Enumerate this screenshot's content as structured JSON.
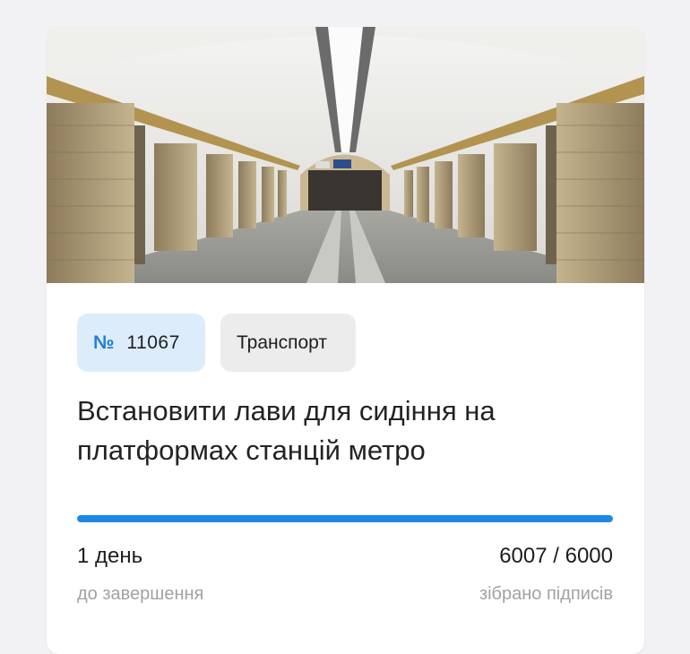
{
  "petition": {
    "image_alt": "metro-station-platform-photo",
    "number_sign": "№",
    "number": "11067",
    "category": "Транспорт",
    "title": "Встановити лави для сидіння на платформах станцій метро",
    "progress_fraction": 1.0,
    "time_left_value": "1 день",
    "time_left_label": "до завершення",
    "signatures_value": "6007 / 6000",
    "signatures_label": "зібрано підписів"
  },
  "colors": {
    "accent": "#1e88e5",
    "number_tag_bg": "#dcecfb",
    "category_tag_bg": "#ececec"
  }
}
